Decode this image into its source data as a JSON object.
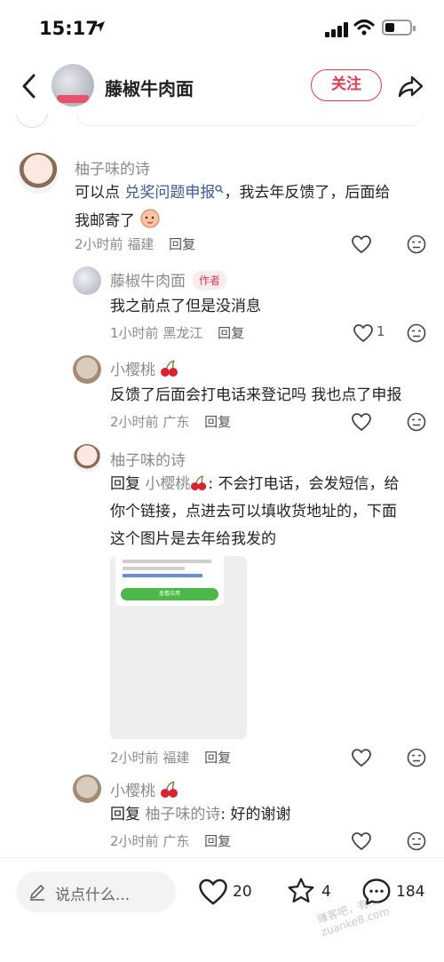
{
  "status_bar": {
    "time": "15:17"
  },
  "header": {
    "title": "藤椒牛肉面",
    "follow_label": "关注"
  },
  "comments": [
    {
      "name": "柚子味的诗",
      "text_before": "可以点",
      "link": "兑奖问题申报",
      "text_after": "，我去年反馈了，后面给",
      "text_line2": "我邮寄了",
      "meta_time": "2小时前",
      "meta_loc": "福建",
      "reply_label": "回复"
    },
    {
      "name": "藤椒牛肉面",
      "author_badge": "作者",
      "text": "我之前点了但是没消息",
      "meta_time": "1小时前",
      "meta_loc": "黑龙江",
      "reply_label": "回复",
      "likes": "1"
    },
    {
      "name": "小樱桃",
      "text": "反馈了后面会打电话来登记吗 我也点了申报",
      "meta_time": "2小时前",
      "meta_loc": "广东",
      "reply_label": "回复"
    },
    {
      "name": "柚子味的诗",
      "reply_prefix": "回复",
      "reply_to": "小樱桃",
      "line1": ": 不会打电话，会发短信，给",
      "line2": "你个链接，点进去可以填收货地址的，下面",
      "line3": "这个图片是去年给我发的",
      "image_text_link": "https://wxaurl.cn/YUt",
      "image_button": "查看应用",
      "meta_time": "2小时前",
      "meta_loc": "福建",
      "reply_label": "回复"
    },
    {
      "name": "小樱桃",
      "reply_prefix": "回复",
      "reply_to": "柚子味的诗",
      "text": ": 好的谢谢",
      "meta_time": "2小时前",
      "meta_loc": "广东",
      "reply_label": "回复"
    }
  ],
  "bottom_bar": {
    "input_placeholder": "说点什么...",
    "likes": "20",
    "stars": "4",
    "comments": "184"
  },
  "watermark": "赚客吧，有... zuanke8.com"
}
